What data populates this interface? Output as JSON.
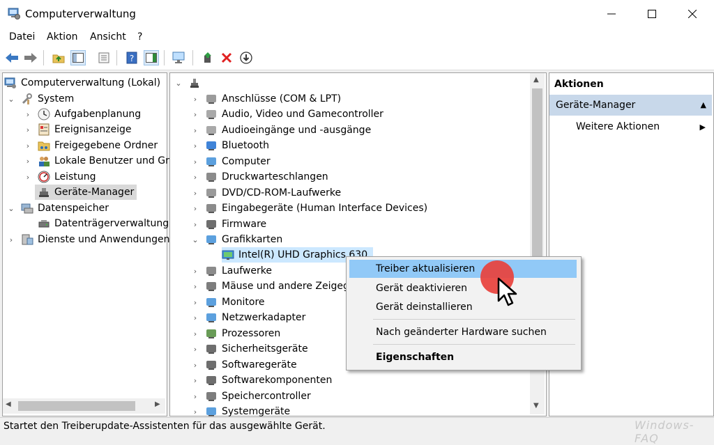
{
  "window": {
    "title": "Computerverwaltung"
  },
  "menu": {
    "items": [
      "Datei",
      "Aktion",
      "Ansicht",
      "?"
    ]
  },
  "left_tree": {
    "root": "Computerverwaltung (Lokal)",
    "system": "System",
    "aufgaben": "Aufgabenplanung",
    "ereignis": "Ereignisanzeige",
    "freigaben": "Freigegebene Ordner",
    "benutzer": "Lokale Benutzer und Gruppen",
    "leistung": "Leistung",
    "geraete": "Geräte-Manager",
    "datenspeicher": "Datenspeicher",
    "datentraeger": "Datenträgerverwaltung",
    "dienste": "Dienste und Anwendungen"
  },
  "device_tree": {
    "categories": [
      "Anschlüsse (COM & LPT)",
      "Audio, Video und Gamecontroller",
      "Audioeingänge und -ausgänge",
      "Bluetooth",
      "Computer",
      "Druckwarteschlangen",
      "DVD/CD-ROM-Laufwerke",
      "Eingabegeräte (Human Interface Devices)",
      "Firmware",
      "Grafikkarten",
      "Laufwerke",
      "Mäuse und andere Zeigegeräte",
      "Monitore",
      "Netzwerkadapter",
      "Prozessoren",
      "Sicherheitsgeräte",
      "Softwaregeräte",
      "Softwarekomponenten",
      "Speichercontroller",
      "Systemgeräte"
    ],
    "gpu_device": "Intel(R) UHD Graphics 630"
  },
  "actions": {
    "header": "Aktionen",
    "section": "Geräte-Manager",
    "more": "Weitere Aktionen"
  },
  "context_menu": {
    "update": "Treiber aktualisieren",
    "disable": "Gerät deaktivieren",
    "uninstall": "Gerät deinstallieren",
    "scan": "Nach geänderter Hardware suchen",
    "properties": "Eigenschaften"
  },
  "status": {
    "text": "Startet den Treiberupdate-Assistenten für das ausgewählte Gerät."
  },
  "watermark": "Windows-FAQ",
  "colors": {
    "accent_select": "#cce8ff",
    "highlight": "#91c9f7",
    "section_bg": "#c8d8ea",
    "pointer_dot": "#e8413c"
  }
}
